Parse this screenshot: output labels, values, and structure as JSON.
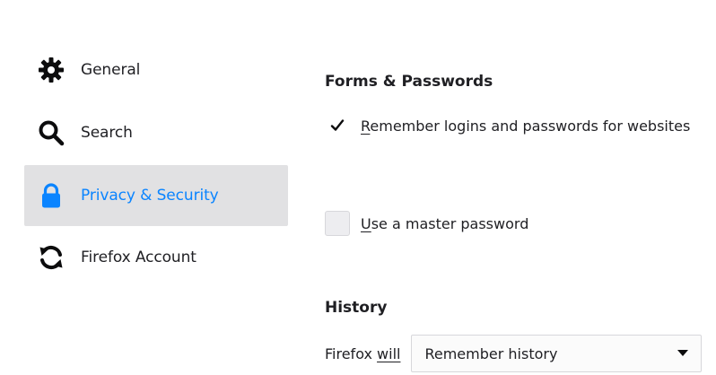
{
  "sidebar": {
    "items": [
      {
        "label": "General",
        "icon": "gear-icon",
        "selected": false
      },
      {
        "label": "Search",
        "icon": "search-icon",
        "selected": false
      },
      {
        "label": "Privacy & Security",
        "icon": "lock-icon",
        "selected": true
      },
      {
        "label": "Firefox Account",
        "icon": "sync-icon",
        "selected": false
      }
    ]
  },
  "forms": {
    "title": "Forms & Passwords",
    "remember_logins": {
      "label": "Remember logins and passwords for websites",
      "checked": true
    },
    "master_password": {
      "label": "Use a master password",
      "checked": false
    }
  },
  "history": {
    "title": "History",
    "firefox_will_prefix": "Firefox ",
    "firefox_will_underlined": "will",
    "select_value": "Remember history"
  },
  "colors": {
    "accent": "#0a84ff",
    "selected_bg": "#e1e1e3",
    "text": "#1f1f23"
  }
}
